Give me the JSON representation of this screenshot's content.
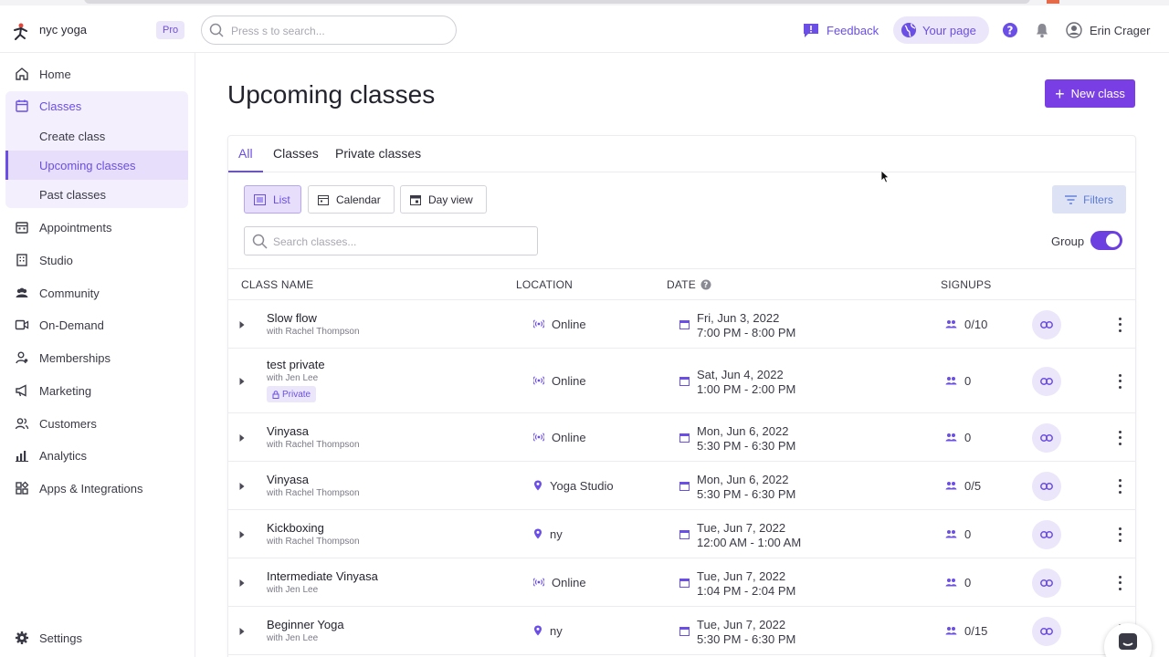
{
  "header": {
    "brand": "nyc yoga",
    "plan_badge": "Pro",
    "search_placeholder": "Press s to search...",
    "feedback_label": "Feedback",
    "your_page_label": "Your page",
    "user_name": "Erin Crager",
    "accent": "#6b4ee6"
  },
  "sidebar": {
    "items": [
      {
        "label": "Home",
        "icon": "home-icon"
      },
      {
        "label": "Classes",
        "icon": "calendar-icon"
      },
      {
        "label": "Appointments",
        "icon": "calendar-grid-icon"
      },
      {
        "label": "Studio",
        "icon": "building-icon"
      },
      {
        "label": "Community",
        "icon": "people-icon"
      },
      {
        "label": "On-Demand",
        "icon": "video-icon"
      },
      {
        "label": "Memberships",
        "icon": "person-badge-icon"
      },
      {
        "label": "Marketing",
        "icon": "megaphone-icon"
      },
      {
        "label": "Customers",
        "icon": "users-icon"
      },
      {
        "label": "Analytics",
        "icon": "chart-icon"
      },
      {
        "label": "Apps & Integrations",
        "icon": "apps-icon"
      }
    ],
    "sub_items": [
      "Create class",
      "Upcoming classes",
      "Past classes"
    ],
    "settings_label": "Settings"
  },
  "main": {
    "title": "Upcoming classes",
    "new_class_label": "New class",
    "tabs": [
      "All",
      "Classes",
      "Private classes"
    ],
    "views": [
      "List",
      "Calendar",
      "Day view"
    ],
    "filters_label": "Filters",
    "search_placeholder": "Search classes...",
    "group_label": "Group",
    "columns": {
      "name": "CLASS NAME",
      "location": "LOCATION",
      "date": "DATE",
      "signups": "SIGNUPS"
    },
    "rows": [
      {
        "name": "Slow flow",
        "instructor": "with Rachel Thompson",
        "location": "Online",
        "location_type": "online",
        "date": "Fri, Jun 3, 2022",
        "time": "7:00 PM - 8:00 PM",
        "signups": "0/10"
      },
      {
        "name": "test private",
        "instructor": "with Jen Lee",
        "badge": "Private",
        "location": "Online",
        "location_type": "online",
        "date": "Sat, Jun 4, 2022",
        "time": "1:00 PM - 2:00 PM",
        "signups": "0"
      },
      {
        "name": "Vinyasa",
        "instructor": "with Rachel Thompson",
        "location": "Online",
        "location_type": "online",
        "date": "Mon, Jun 6, 2022",
        "time": "5:30 PM - 6:30 PM",
        "signups": "0"
      },
      {
        "name": "Vinyasa",
        "instructor": "with Rachel Thompson",
        "location": "Yoga Studio",
        "location_type": "place",
        "date": "Mon, Jun 6, 2022",
        "time": "5:30 PM - 6:30 PM",
        "signups": "0/5"
      },
      {
        "name": "Kickboxing",
        "instructor": "with Rachel Thompson",
        "location": "ny",
        "location_type": "place",
        "date": "Tue, Jun 7, 2022",
        "time": "12:00 AM - 1:00 AM",
        "signups": "0"
      },
      {
        "name": "Intermediate Vinyasa",
        "instructor": "with Jen Lee",
        "location": "Online",
        "location_type": "online",
        "date": "Tue, Jun 7, 2022",
        "time": "1:04 PM - 2:04 PM",
        "signups": "0"
      },
      {
        "name": "Beginner Yoga",
        "instructor": "with Jen Lee",
        "location": "ny",
        "location_type": "place",
        "date": "Tue, Jun 7, 2022",
        "time": "5:30 PM - 6:30 PM",
        "signups": "0/15"
      }
    ]
  }
}
